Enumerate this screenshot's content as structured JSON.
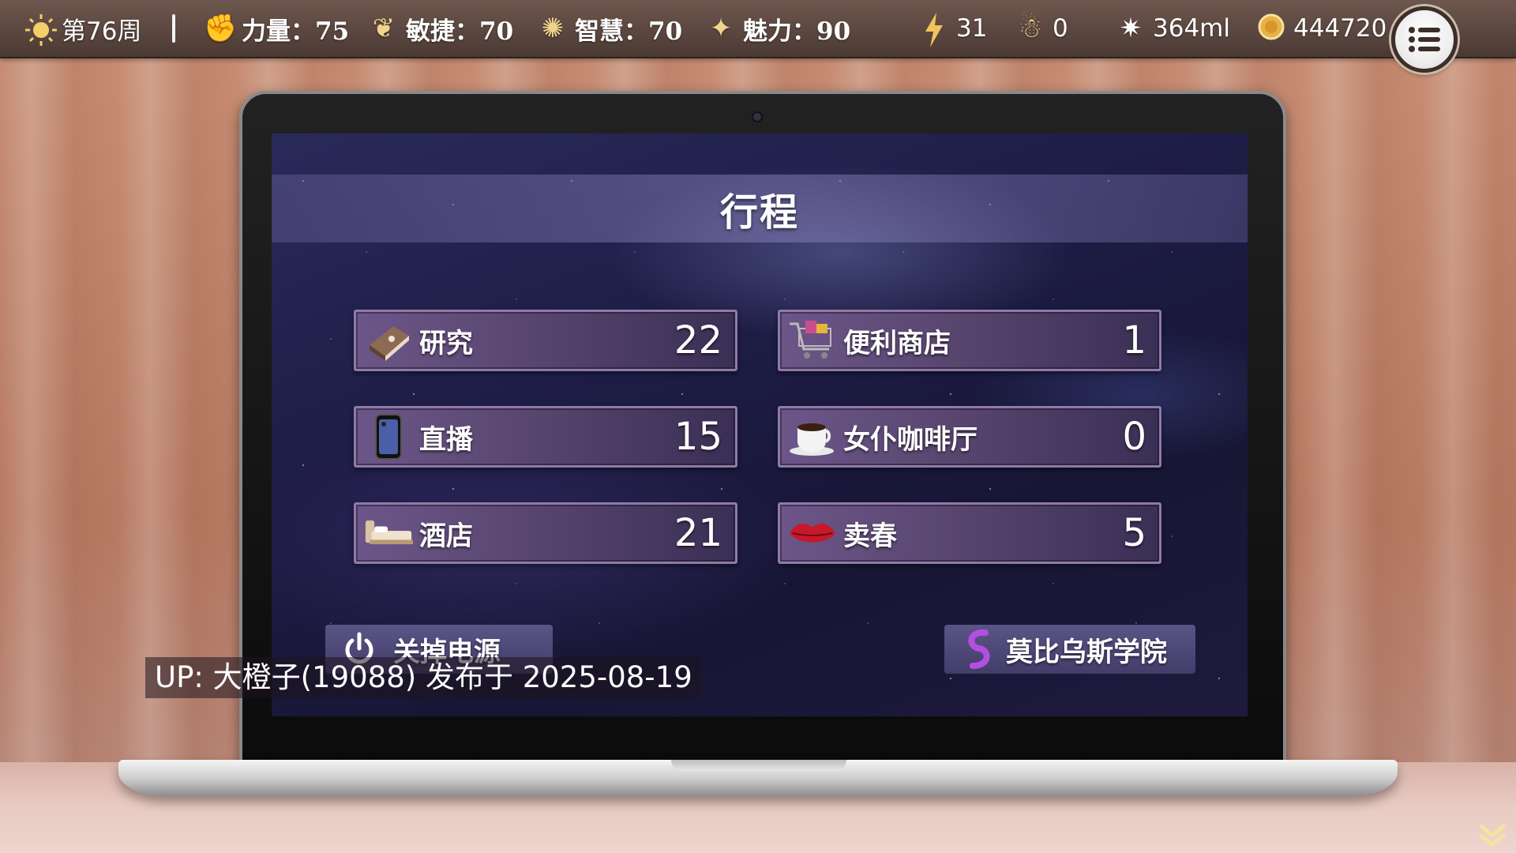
{
  "status_bar": {
    "week": "第76周",
    "strength": "力量：75",
    "agility": "敏捷：70",
    "wisdom": "智慧：70",
    "charm": "魅力：90",
    "energy": "31",
    "followers": "0",
    "fluid": "364ml",
    "gold": "444720"
  },
  "screen": {
    "title": "行程",
    "items": [
      {
        "name": "研究",
        "count": "22",
        "icon": "book-icon"
      },
      {
        "name": "便利商店",
        "count": "1",
        "icon": "shopping-cart-icon"
      },
      {
        "name": "直播",
        "count": "15",
        "icon": "smartphone-icon"
      },
      {
        "name": "女仆咖啡厅",
        "count": "0",
        "icon": "coffee-cup-icon"
      },
      {
        "name": "酒店",
        "count": "21",
        "icon": "bed-icon"
      },
      {
        "name": "卖春",
        "count": "5",
        "icon": "lips-icon"
      }
    ],
    "power_off_label": "关掉电源",
    "academy_label": "莫比乌斯学院"
  },
  "watermark": "UP: 大橙子(19088) 发布于 2025-08-19",
  "colors": {
    "topbar": "#5b4740",
    "item_bg": "#59466f",
    "item_border": "#8e7aa8",
    "screen_bg": "#1d1c45"
  }
}
